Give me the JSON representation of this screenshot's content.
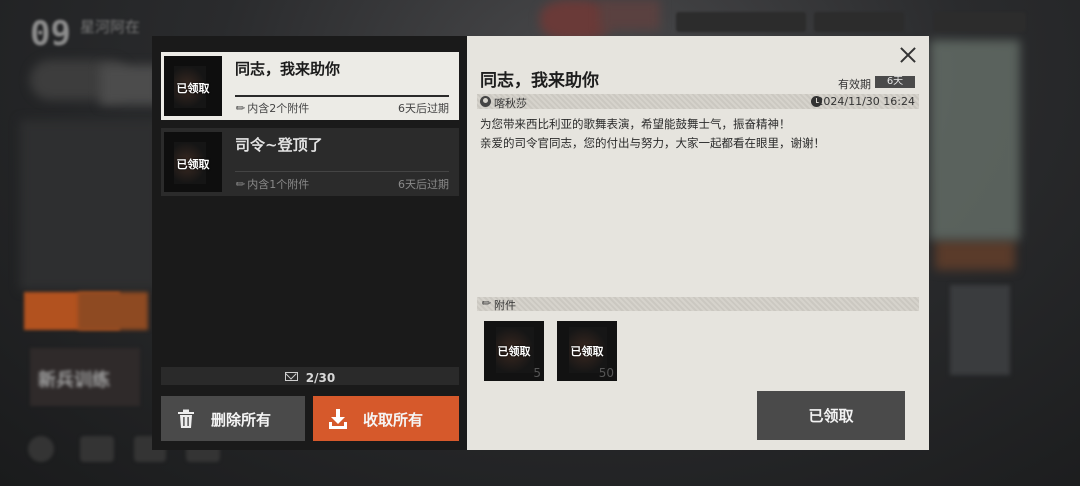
{
  "background": {
    "day_number": "09",
    "day_label": "星河阿在",
    "resources": [
      "",
      "",
      ""
    ],
    "training_label": "新兵训练"
  },
  "mail_list": [
    {
      "thumb_tag": "已领取",
      "title": "同志，我来助你",
      "attachments": "内含2个附件",
      "expire": "6天后过期",
      "selected": true
    },
    {
      "thumb_tag": "已领取",
      "title": "司令~登顶了",
      "attachments": "内含1个附件",
      "expire": "6天后过期",
      "selected": false
    }
  ],
  "mail_count": "2/30",
  "buttons": {
    "delete_all": "删除所有",
    "claim_all": "收取所有",
    "claimed": "已领取"
  },
  "detail": {
    "title": "同志，我来助你",
    "validity_label": "有效期",
    "validity_value": "6天",
    "sender": "喀秋莎",
    "datetime": "2024/11/30 16:24",
    "body": [
      "为您带来西比利亚的歌舞表演，希望能鼓舞士气，振奋精神！",
      "亲爱的司令官同志，您的付出与努力，大家一起都看在眼里，谢谢！"
    ],
    "attachments_label": "附件",
    "attachments": [
      {
        "tag": "已领取",
        "qty": "5"
      },
      {
        "tag": "已领取",
        "qty": "50"
      }
    ]
  },
  "colors": {
    "accent": "#d6592b",
    "panel_dark": "#1a1a1a",
    "panel_light": "#e6e4de",
    "button_gray": "#4a4a4a"
  }
}
